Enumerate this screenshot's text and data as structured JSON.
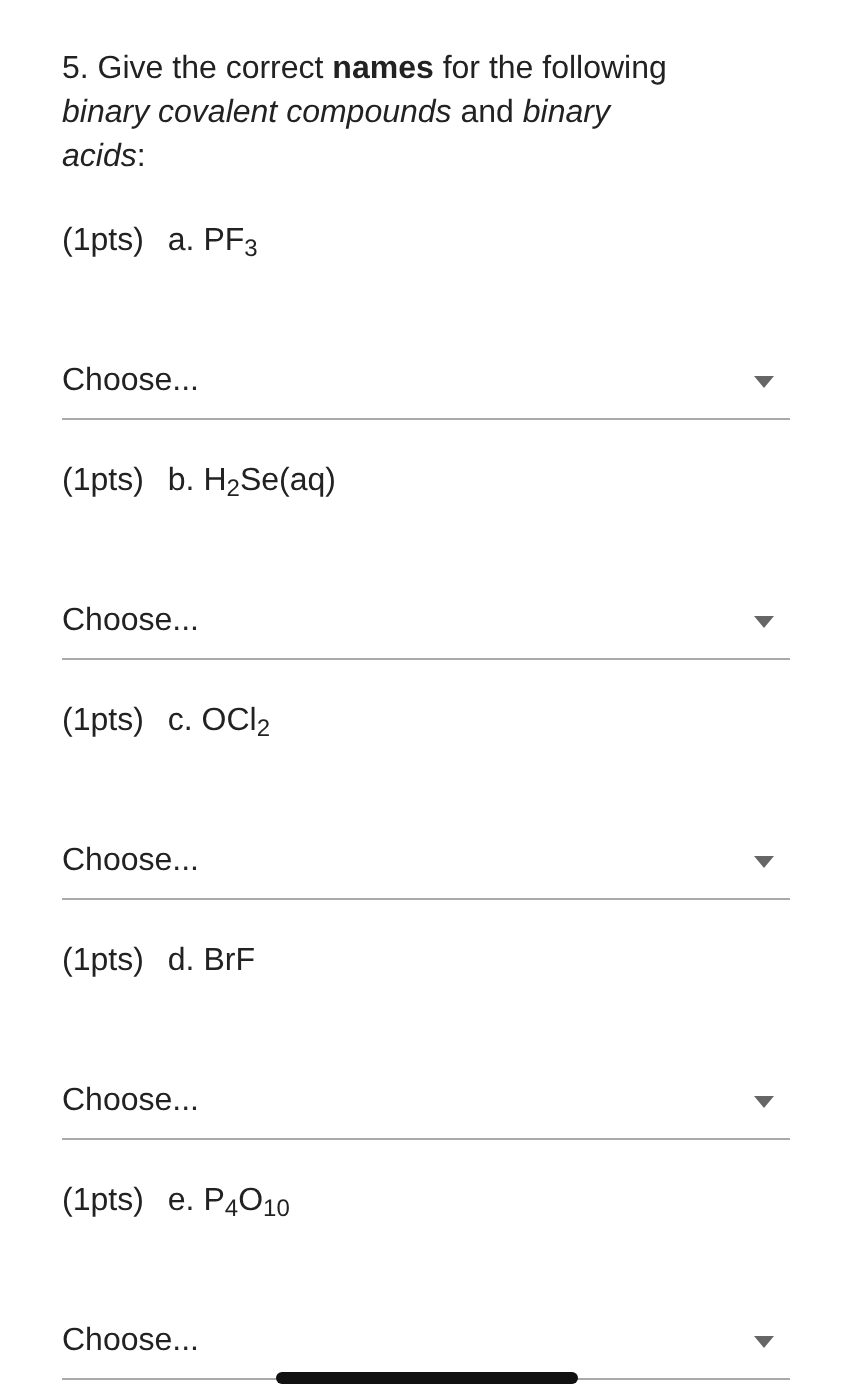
{
  "question": "5. Give the correct **names** for the following *binary covalent compounds* and *binary acids*:",
  "parts": [
    {
      "points": "(1pts)",
      "label": "a. PF$_{3}$",
      "dropdown": "Choose..."
    },
    {
      "points": "(1pts)",
      "label": "b. H$_{2}$Se(aq)",
      "dropdown": "Choose..."
    },
    {
      "points": "(1pts)",
      "label": "c. OCl$_{2}$",
      "dropdown": "Choose..."
    },
    {
      "points": "(1pts)",
      "label": "d. BrF",
      "dropdown": "Choose..."
    },
    {
      "points": "(1pts)",
      "label": "e. P$_{4}$O$_{10}$",
      "dropdown": "Choose..."
    }
  ]
}
